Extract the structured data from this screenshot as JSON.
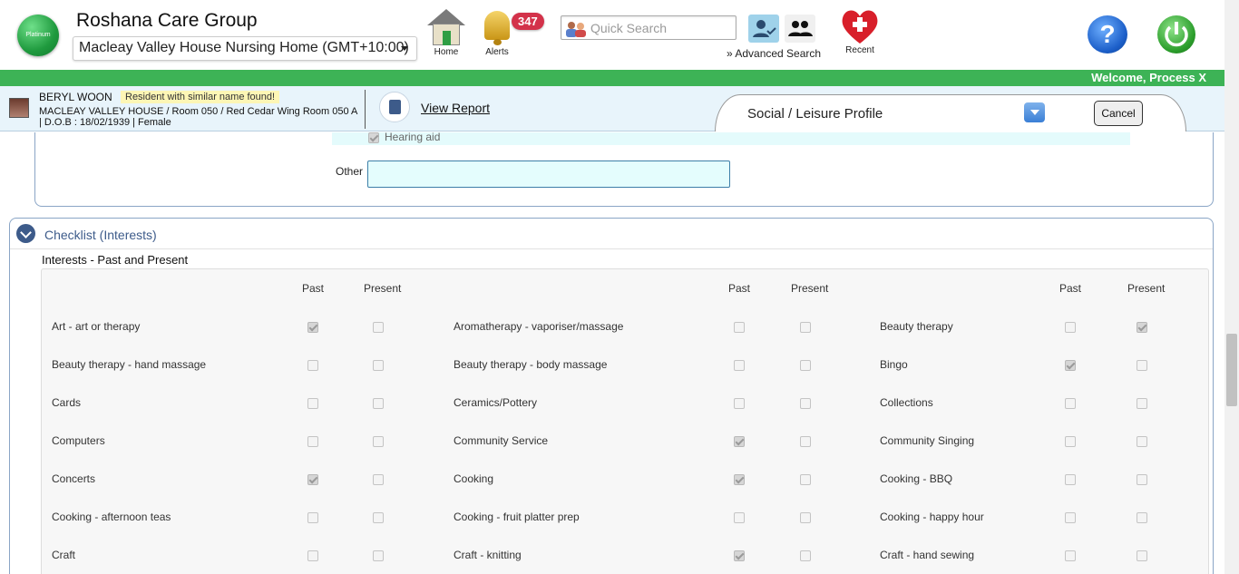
{
  "header": {
    "logo_text": "Platinum",
    "org_name": "Roshana Care Group",
    "facility": "Macleay Valley House Nursing Home (GMT+10:00)",
    "home_label": "Home",
    "alerts_label": "Alerts",
    "alerts_count": "347",
    "search_placeholder": "Quick Search",
    "advanced_search": "» Advanced Search",
    "recent_label": "Recent",
    "icons": [
      "home-icon",
      "bell-icon",
      "people-icon",
      "user-check-icon",
      "users-icon",
      "heart-plus-icon",
      "help-icon",
      "power-icon"
    ]
  },
  "welcome": "Welcome, Process X",
  "resident": {
    "name": "BERYL WOON",
    "flag": "Resident with similar name found!",
    "location": "MACLEAY VALLEY HOUSE / Room 050 / Red Cedar Wing Room 050 A",
    "dob": "| D.O.B : 18/02/1939 | Female",
    "view_report": "View Report"
  },
  "profile": {
    "title": "Social / Leisure Profile",
    "cancel": "Cancel"
  },
  "previous_section": {
    "hearing_aid": "Hearing aid",
    "other_label": "Other",
    "other_value": ""
  },
  "checklist": {
    "title": "Checklist (Interests)",
    "subtitle": "Interests - Past and Present",
    "col_past": "Past",
    "col_present": "Present",
    "rows": [
      [
        {
          "label": "Art - art or therapy",
          "past": true,
          "present": false
        },
        {
          "label": "Aromatherapy - vaporiser/massage",
          "past": false,
          "present": false
        },
        {
          "label": "Beauty therapy",
          "past": false,
          "present": true
        }
      ],
      [
        {
          "label": "Beauty therapy - hand massage",
          "past": false,
          "present": false
        },
        {
          "label": "Beauty therapy - body massage",
          "past": false,
          "present": false
        },
        {
          "label": "Bingo",
          "past": true,
          "present": false
        }
      ],
      [
        {
          "label": "Cards",
          "past": false,
          "present": false
        },
        {
          "label": "Ceramics/Pottery",
          "past": false,
          "present": false
        },
        {
          "label": "Collections",
          "past": false,
          "present": false
        }
      ],
      [
        {
          "label": "Computers",
          "past": false,
          "present": false
        },
        {
          "label": "Community Service",
          "past": true,
          "present": false
        },
        {
          "label": "Community Singing",
          "past": false,
          "present": false
        }
      ],
      [
        {
          "label": "Concerts",
          "past": true,
          "present": false
        },
        {
          "label": "Cooking",
          "past": true,
          "present": false
        },
        {
          "label": "Cooking - BBQ",
          "past": false,
          "present": false
        }
      ],
      [
        {
          "label": "Cooking - afternoon teas",
          "past": false,
          "present": false
        },
        {
          "label": "Cooking - fruit platter prep",
          "past": false,
          "present": false
        },
        {
          "label": "Cooking - happy hour",
          "past": false,
          "present": false
        }
      ],
      [
        {
          "label": "Craft",
          "past": false,
          "present": false
        },
        {
          "label": "Craft - knitting",
          "past": true,
          "present": false
        },
        {
          "label": "Craft - hand sewing",
          "past": false,
          "present": false
        }
      ]
    ]
  }
}
